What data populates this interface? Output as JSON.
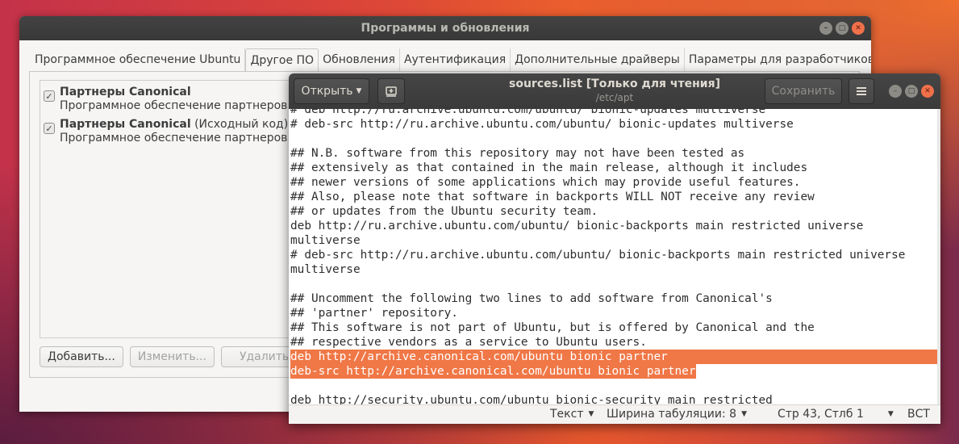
{
  "software_window": {
    "title": "Программы и обновления",
    "tabs": [
      "Программное обеспечение Ubuntu",
      "Другое ПО",
      "Обновления",
      "Аутентификация",
      "Дополнительные драйверы",
      "Параметры для разработчиков"
    ],
    "active_tab_index": 1,
    "sources": [
      {
        "checked": true,
        "title": "Партнеры Canonical",
        "title_suffix": "",
        "description": "Программное обеспечение партнеров Canonical"
      },
      {
        "checked": true,
        "title": "Партнеры Canonical",
        "title_suffix": " (Исходный код)",
        "description": "Программное обеспечение партнеров Canonical"
      }
    ],
    "buttons": {
      "add": "Добавить...",
      "edit": "Изменить...",
      "remove": "Удалить"
    }
  },
  "editor_window": {
    "open_label": "Открыть",
    "title": "sources.list [Только для чтения]",
    "subtitle": "/etc/apt",
    "save_label": "Сохранить",
    "menu_icon": "hamburger-menu-icon",
    "lines": [
      {
        "text": "# deb http://ru.archive.ubuntu.com/ubuntu/ bionic-updates multiverse",
        "selected": false
      },
      {
        "text": "# deb-src http://ru.archive.ubuntu.com/ubuntu/ bionic-updates multiverse",
        "selected": false
      },
      {
        "text": "",
        "selected": false
      },
      {
        "text": "## N.B. software from this repository may not have been tested as",
        "selected": false
      },
      {
        "text": "## extensively as that contained in the main release, although it includes",
        "selected": false
      },
      {
        "text": "## newer versions of some applications which may provide useful features.",
        "selected": false
      },
      {
        "text": "## Also, please note that software in backports WILL NOT receive any review",
        "selected": false
      },
      {
        "text": "## or updates from the Ubuntu security team.",
        "selected": false
      },
      {
        "text": "deb http://ru.archive.ubuntu.com/ubuntu/ bionic-backports main restricted universe",
        "selected": false
      },
      {
        "text": "multiverse",
        "selected": false
      },
      {
        "text": "# deb-src http://ru.archive.ubuntu.com/ubuntu/ bionic-backports main restricted universe",
        "selected": false
      },
      {
        "text": "multiverse",
        "selected": false
      },
      {
        "text": "",
        "selected": false
      },
      {
        "text": "## Uncomment the following two lines to add software from Canonical's",
        "selected": false
      },
      {
        "text": "## 'partner' repository.",
        "selected": false
      },
      {
        "text": "## This software is not part of Ubuntu, but is offered by Canonical and the",
        "selected": false
      },
      {
        "text": "## respective vendors as a service to Ubuntu users.",
        "selected": false
      },
      {
        "text": "deb http://archive.canonical.com/ubuntu bionic partner",
        "selected": true,
        "full": true
      },
      {
        "text": "deb-src http://archive.canonical.com/ubuntu bionic partner",
        "selected": true,
        "full": false
      },
      {
        "text": "",
        "selected": false
      },
      {
        "text": "deb http://security.ubuntu.com/ubuntu bionic-security main restricted",
        "selected": false
      }
    ],
    "status": {
      "syntax": "Текст",
      "tab_width": "Ширина табуляции: 8",
      "position": "Стр 43, Стлб 1",
      "insert_mode": "ВСТ"
    }
  }
}
